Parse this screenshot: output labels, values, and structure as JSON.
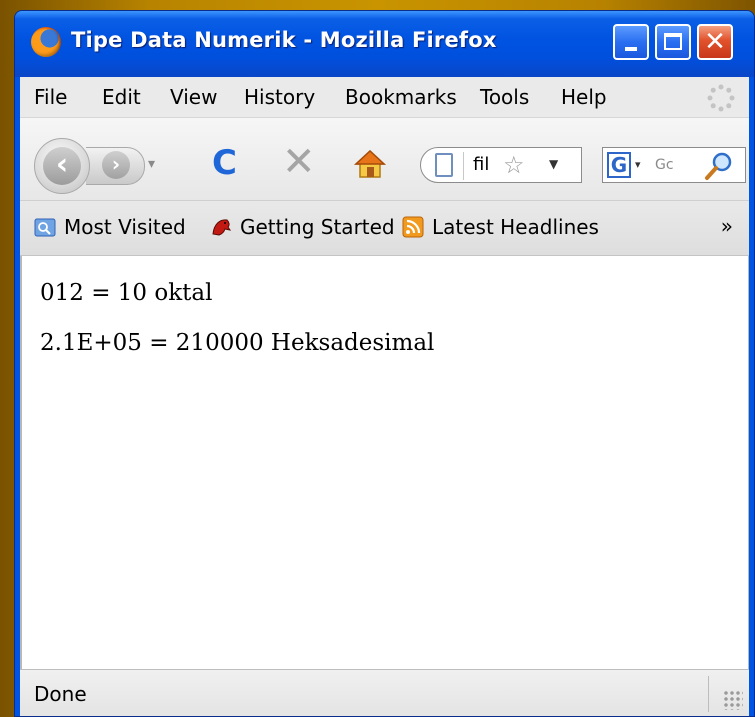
{
  "window": {
    "title": "Tipe Data Numerik - Mozilla Firefox"
  },
  "menu": [
    "File",
    "Edit",
    "View",
    "History",
    "Bookmarks",
    "Tools",
    "Help"
  ],
  "toolbar": {
    "url_text": "fil",
    "search_placeholder": "Gc",
    "search_engine_letter": "G"
  },
  "bookmarks": [
    "Most Visited",
    "Getting Started",
    "Latest Headlines"
  ],
  "bookmarks_overflow": "»",
  "content": {
    "lines": [
      "012 = 10 oktal",
      "2.1E+05 = 210000 Heksadesimal"
    ]
  },
  "status": {
    "text": "Done"
  }
}
